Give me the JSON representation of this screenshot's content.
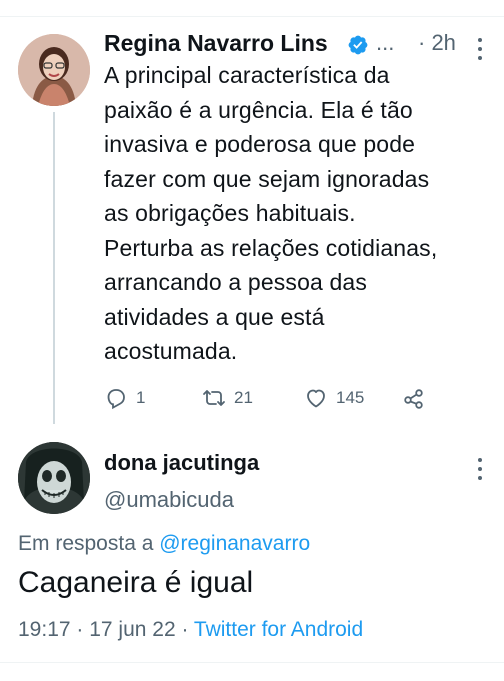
{
  "tweet": {
    "author_name": "Regina Navarro Lins",
    "name_overflow": "...",
    "time": "· 2h",
    "body_lines": [
      "A principal característica da",
      "paixão é a urgência. Ela é tão",
      "invasiva e poderosa que pode",
      "fazer com que sejam ignoradas",
      "as obrigações habituais.",
      "Perturba as relações cotidianas,",
      "arrancando a pessoa das",
      "atividades a que está",
      "acostumada."
    ],
    "reply_count": "1",
    "retweet_count": "21",
    "like_count": "145"
  },
  "reply": {
    "author_name": "dona jacutinga",
    "handle": "@umabicuda",
    "in_reply_prefix": "Em resposta a ",
    "in_reply_mention": "@reginanavarro",
    "text": "Caganeira é igual",
    "time": "19:17 · 17 jun 22 · ",
    "source": "Twitter for Android"
  },
  "colors": {
    "text": "#0f1419",
    "secondary": "#536471",
    "accent": "#1d9bf0",
    "thread_line": "#cfd9de"
  },
  "icons": [
    "verified-badge-icon",
    "more-icon",
    "reply-icon",
    "retweet-icon",
    "like-icon",
    "share-icon"
  ]
}
